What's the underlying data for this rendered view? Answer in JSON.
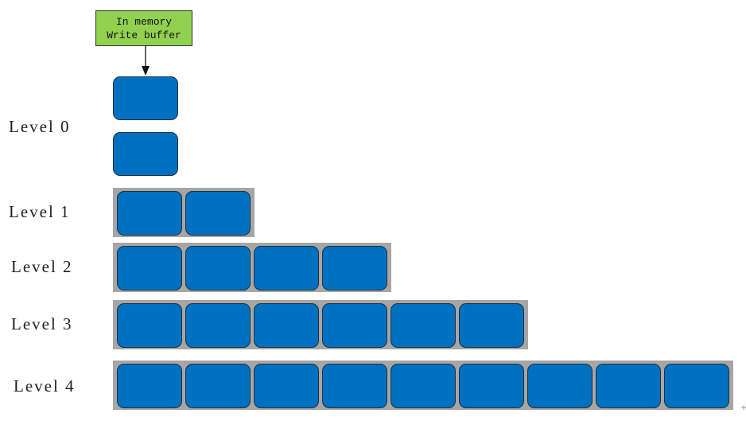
{
  "buffer": {
    "line1": "In memory",
    "line2": "Write buffer",
    "color": "#92d050"
  },
  "levels": [
    {
      "label": "Level 0",
      "sstables": 2
    },
    {
      "label": "Level 1",
      "sstables": 2
    },
    {
      "label": "Level 2",
      "sstables": 4
    },
    {
      "label": "Level 3",
      "sstables": 6
    },
    {
      "label": "Level 4",
      "sstables": 9
    }
  ],
  "colors": {
    "sstable": "#0070c0",
    "tray": "#a6a6a6"
  }
}
